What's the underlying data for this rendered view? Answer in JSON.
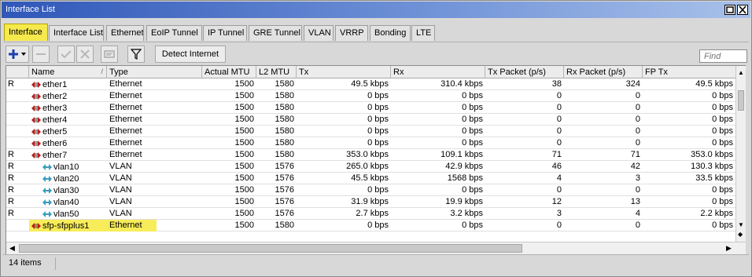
{
  "window": {
    "title": "Interface List"
  },
  "tabs": [
    {
      "label": "Interface",
      "active": true
    },
    {
      "label": "Interface List"
    },
    {
      "label": "Ethernet"
    },
    {
      "label": "EoIP Tunnel"
    },
    {
      "label": "IP Tunnel"
    },
    {
      "label": "GRE Tunnel"
    },
    {
      "label": "VLAN"
    },
    {
      "label": "VRRP"
    },
    {
      "label": "Bonding"
    },
    {
      "label": "LTE"
    }
  ],
  "toolbar": {
    "add_icon": "plus-dropdown-icon",
    "detect_label": "Detect Internet",
    "find_placeholder": "Find"
  },
  "columns": [
    "",
    "Name",
    "Type",
    "Actual MTU",
    "L2 MTU",
    "Tx",
    "Rx",
    "Tx Packet (p/s)",
    "Rx Packet (p/s)",
    "FP Tx"
  ],
  "sort_indicator": "/",
  "rows": [
    {
      "flag": "R",
      "name": "ether1",
      "type": "Ethernet",
      "mtu": "1500",
      "l2mtu": "1580",
      "tx": "49.5 kbps",
      "rx": "310.4 kbps",
      "txp": "38",
      "rxp": "324",
      "fptx": "49.5 kbps",
      "kind": "ethernet"
    },
    {
      "flag": "",
      "name": "ether2",
      "type": "Ethernet",
      "mtu": "1500",
      "l2mtu": "1580",
      "tx": "0 bps",
      "rx": "0 bps",
      "txp": "0",
      "rxp": "0",
      "fptx": "0 bps",
      "kind": "ethernet"
    },
    {
      "flag": "",
      "name": "ether3",
      "type": "Ethernet",
      "mtu": "1500",
      "l2mtu": "1580",
      "tx": "0 bps",
      "rx": "0 bps",
      "txp": "0",
      "rxp": "0",
      "fptx": "0 bps",
      "kind": "ethernet"
    },
    {
      "flag": "",
      "name": "ether4",
      "type": "Ethernet",
      "mtu": "1500",
      "l2mtu": "1580",
      "tx": "0 bps",
      "rx": "0 bps",
      "txp": "0",
      "rxp": "0",
      "fptx": "0 bps",
      "kind": "ethernet"
    },
    {
      "flag": "",
      "name": "ether5",
      "type": "Ethernet",
      "mtu": "1500",
      "l2mtu": "1580",
      "tx": "0 bps",
      "rx": "0 bps",
      "txp": "0",
      "rxp": "0",
      "fptx": "0 bps",
      "kind": "ethernet"
    },
    {
      "flag": "",
      "name": "ether6",
      "type": "Ethernet",
      "mtu": "1500",
      "l2mtu": "1580",
      "tx": "0 bps",
      "rx": "0 bps",
      "txp": "0",
      "rxp": "0",
      "fptx": "0 bps",
      "kind": "ethernet"
    },
    {
      "flag": "R",
      "name": "ether7",
      "type": "Ethernet",
      "mtu": "1500",
      "l2mtu": "1580",
      "tx": "353.0 kbps",
      "rx": "109.1 kbps",
      "txp": "71",
      "rxp": "71",
      "fptx": "353.0 kbps",
      "kind": "ethernet"
    },
    {
      "flag": "R",
      "name": "vlan10",
      "type": "VLAN",
      "mtu": "1500",
      "l2mtu": "1576",
      "tx": "265.0 kbps",
      "rx": "42.9 kbps",
      "txp": "46",
      "rxp": "42",
      "fptx": "130.3 kbps",
      "kind": "vlan"
    },
    {
      "flag": "R",
      "name": "vlan20",
      "type": "VLAN",
      "mtu": "1500",
      "l2mtu": "1576",
      "tx": "45.5 kbps",
      "rx": "1568 bps",
      "txp": "4",
      "rxp": "3",
      "fptx": "33.5 kbps",
      "kind": "vlan"
    },
    {
      "flag": "R",
      "name": "vlan30",
      "type": "VLAN",
      "mtu": "1500",
      "l2mtu": "1576",
      "tx": "0 bps",
      "rx": "0 bps",
      "txp": "0",
      "rxp": "0",
      "fptx": "0 bps",
      "kind": "vlan"
    },
    {
      "flag": "R",
      "name": "vlan40",
      "type": "VLAN",
      "mtu": "1500",
      "l2mtu": "1576",
      "tx": "31.9 kbps",
      "rx": "19.9 kbps",
      "txp": "12",
      "rxp": "13",
      "fptx": "0 bps",
      "kind": "vlan"
    },
    {
      "flag": "R",
      "name": "vlan50",
      "type": "VLAN",
      "mtu": "1500",
      "l2mtu": "1576",
      "tx": "2.7 kbps",
      "rx": "3.2 kbps",
      "txp": "3",
      "rxp": "4",
      "fptx": "2.2 kbps",
      "kind": "vlan"
    },
    {
      "flag": "",
      "name": "sfp-sfpplus1",
      "type": "Ethernet",
      "mtu": "1500",
      "l2mtu": "1580",
      "tx": "0 bps",
      "rx": "0 bps",
      "txp": "0",
      "rxp": "0",
      "fptx": "0 bps",
      "kind": "ethernet",
      "highlight": true
    }
  ],
  "status": {
    "count": "14 items"
  },
  "colors": {
    "tab_active": "#f5e94c",
    "title_bar": "#2f57b8",
    "highlight": "#f7ec59"
  }
}
